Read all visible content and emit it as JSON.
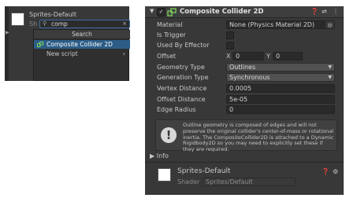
{
  "left": {
    "sprite_name": "Sprites-Default",
    "shader_label": "Sh",
    "search_value": "comp",
    "clear_glyph": "×",
    "menu": {
      "header": "Search",
      "items": [
        {
          "label": "Composite Collider 2D",
          "selected": true
        },
        {
          "label": "New script",
          "selected": false
        }
      ],
      "chevron": "›"
    }
  },
  "right": {
    "title": "Composite Collider 2D",
    "rows": {
      "material_label": "Material",
      "material_value": "None (Physics Material 2D)",
      "trigger_label": "Is Trigger",
      "effector_label": "Used By Effector",
      "offset_label": "Offset",
      "offset_x_label": "X",
      "offset_x": "0",
      "offset_y_label": "Y",
      "offset_y": "0",
      "geom_label": "Geometry Type",
      "geom_value": "Outlines",
      "gen_label": "Generation Type",
      "gen_value": "Synchronous",
      "vertex_label": "Vertex Distance",
      "vertex_value": "0.0005",
      "offdist_label": "Offset Distance",
      "offdist_value": "5e-05",
      "edge_label": "Edge Radius",
      "edge_value": "0"
    },
    "info_text": "Outline geometry is composed of edges and will not preserve the original collider's center-of-mass or rotational inertia.  The CompositeCollider2D is attached to a Dynamic Rigidbody2D so you may need to explicitly set these if they are required.",
    "info_foldout": "Info",
    "material_name": "Sprites-Default",
    "shader_label": "Shader",
    "shader_value": "Sprites/Default"
  },
  "colors": {
    "panel": "#383838",
    "highlight": "#2c5d87",
    "field": "#2a2a2a"
  }
}
